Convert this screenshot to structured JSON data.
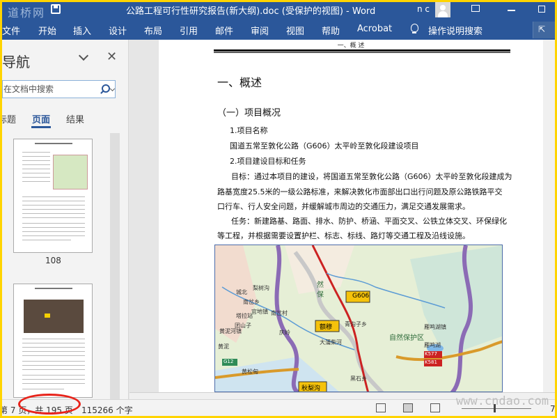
{
  "watermark_logo": "道桥网",
  "window_title": "公路工程可行性研究报告(新大纲).doc (受保护的视图) - Word",
  "user_name": "n c",
  "ribbon_tabs": [
    "文件",
    "开始",
    "插入",
    "设计",
    "布局",
    "引用",
    "邮件",
    "审阅",
    "视图",
    "帮助",
    "Acrobat"
  ],
  "tell_me": "操作说明搜索",
  "nav": {
    "title": "导航",
    "search_placeholder": "在文档中搜索",
    "tabs": [
      "标题",
      "页面",
      "结果"
    ],
    "active_tab": "页面",
    "thumbnails": [
      {
        "label": "108"
      },
      {
        "label": ""
      }
    ]
  },
  "document": {
    "header": "一、概  述",
    "heading1": "一、概述",
    "heading2": "（一）项目概况",
    "paragraphs": [
      "1.项目名称",
      "国道五常至敦化公路（G606）太平岭至敦化段建设项目",
      "2.项目建设目标和任务",
      "目标：通过本项目的建设，将国道五常至敦化公路（G606）太平岭至敦化段建成为",
      "路基宽度25.5米的一级公路标准，来解决敦化市面部出口出行问题及原公路铁路平交",
      "口行车、行人安全问题，并缓解城市周边的交通压力，满足交通发展需求。",
      "任务：新建路基、路面、排水、防护、桥涵、平面交叉、公铁立体交叉、环保绿化",
      "等工程，并根据需要设置护栏、标志、标线、路灯等交通工程及沿线设施。"
    ],
    "map_labels": [
      "G606",
      "额穆",
      "秋梨沟",
      "官地镇",
      "黄松甸",
      "南岔乡",
      "塔拉站",
      "团山子",
      "庆岭",
      "大蒲柴河",
      "青沟子乡",
      "雁鸣湖镇",
      "黑石乡",
      "雁鸣湖",
      "K577",
      "K581",
      "城北",
      "黄泥",
      "G12",
      "南岔村",
      "梨树沟",
      "黄泥河镇",
      "自然保护区",
      "然",
      "保"
    ]
  },
  "status": {
    "page_info": "第 7 页，共 195 页",
    "word_count": "115266 个字",
    "zoom_tail": "7"
  },
  "site_watermark": "www.cndao.com"
}
